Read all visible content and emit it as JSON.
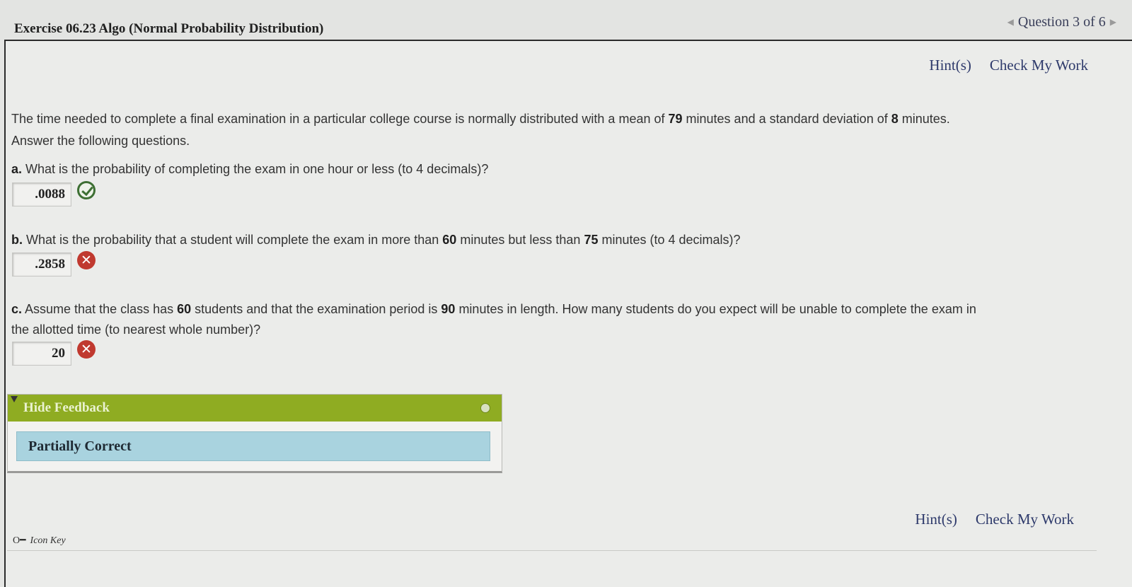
{
  "header": {
    "exercise_title": "Exercise 06.23 Algo (Normal Probability Distribution)",
    "question_nav": "Question 3 of 6",
    "prev_icon": "triangle-left-icon",
    "next_icon": "triangle-right-icon"
  },
  "links": {
    "hints": "Hint(s)",
    "check": "Check My Work"
  },
  "intro": {
    "t1": "The time needed to complete a final examination in a particular college course is normally distributed with a mean of ",
    "mean": "79",
    "t2": " minutes and a standard deviation of ",
    "sd": "8",
    "t3": " minutes.",
    "line2": "Answer the following questions."
  },
  "part_a": {
    "letter": "a.",
    "text": " What is the probability of completing the exam in one hour or less (to 4 decimals)?",
    "answer": ".0088",
    "status": "correct"
  },
  "part_b": {
    "letter": "b.",
    "t1": " What is the probability that a student will complete the exam in more than ",
    "v1": "60",
    "t2": " minutes but less than ",
    "v2": "75",
    "t3": " minutes (to 4 decimals)?",
    "answer": ".2858",
    "status": "incorrect"
  },
  "part_c": {
    "letter": "c.",
    "t1": " Assume that the class has ",
    "v1": "60",
    "t2": " students and that the examination period is ",
    "v2": "90",
    "t3": " minutes in length. How many students do you expect will be unable to complete the exam in",
    "line2": "the allotted time (to nearest whole number)?",
    "answer": "20",
    "status": "incorrect"
  },
  "feedback": {
    "toggle_label": "Hide Feedback",
    "result": "Partially Correct"
  },
  "icon_key": "Icon Key",
  "colors": {
    "feedback_header": "#8fac22",
    "feedback_result": "#a9d3df",
    "correct": "#3d6f33",
    "incorrect": "#c0392f"
  }
}
